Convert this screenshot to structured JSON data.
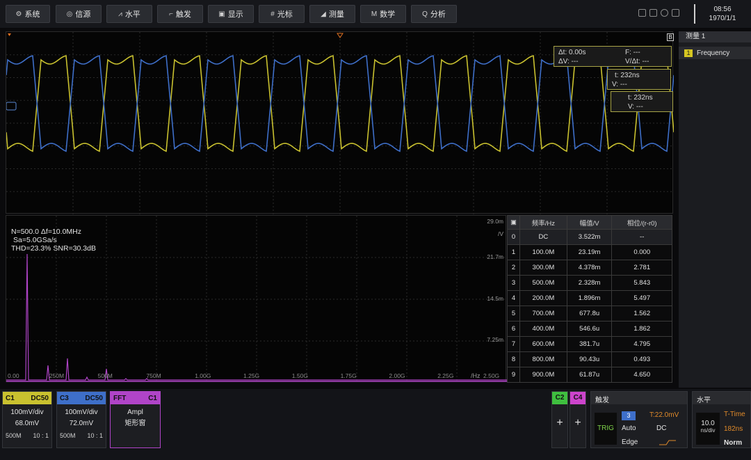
{
  "toolbar": {
    "buttons": [
      {
        "label": "系统",
        "icon": "gear-icon"
      },
      {
        "label": "信源",
        "icon": "source-icon"
      },
      {
        "label": "水平",
        "icon": "horizontal-icon"
      },
      {
        "label": "触发",
        "icon": "trigger-icon"
      },
      {
        "label": "显示",
        "icon": "display-icon"
      },
      {
        "label": "光标",
        "icon": "cursor-icon"
      },
      {
        "label": "测量",
        "icon": "measure-icon"
      },
      {
        "label": "数学",
        "icon": "math-icon"
      },
      {
        "label": "分析",
        "icon": "search-icon"
      }
    ],
    "time": "08:56",
    "date": "1970/1/1"
  },
  "scope": {
    "marker_b": "B",
    "cursor_main": {
      "dt": "Δt: 0.00s",
      "f": "F: ---",
      "dv": "ΔV: ---",
      "vdt": "V/Δt: ---"
    },
    "cursor_a": {
      "t": "t: 232ns",
      "v": "V: ---"
    },
    "cursor_b": {
      "t": "t: 232ns",
      "v": "V: ---"
    },
    "colors": {
      "c1": "#c9c12f",
      "c3": "#3e6fc9"
    }
  },
  "fft": {
    "info1": "N=500.0 Δf=10.0MHz",
    "info2": "Sa=5.0GSa/s",
    "info3": "THD=23.3% SNR=30.3dB",
    "y_labels": [
      "29.0m",
      "21.7m",
      "14.5m",
      "7.25m"
    ],
    "y_unit": "/V",
    "x_labels": [
      "0.00",
      "250M",
      "500M",
      "750M",
      "1.00G",
      "1.25G",
      "1.50G",
      "1.75G",
      "2.00G",
      "2.25G",
      "2.50G"
    ],
    "x_unit": "/Hz",
    "color": "#b044c8"
  },
  "table": {
    "headers": [
      "频率/Hz",
      "幅值/V",
      "相位/(r-r0)"
    ],
    "rows": [
      [
        "0",
        "DC",
        "3.522m",
        "--"
      ],
      [
        "1",
        "100.0M",
        "23.19m",
        "0.000"
      ],
      [
        "2",
        "300.0M",
        "4.378m",
        "2.781"
      ],
      [
        "3",
        "500.0M",
        "2.328m",
        "5.843"
      ],
      [
        "4",
        "200.0M",
        "1.896m",
        "5.497"
      ],
      [
        "5",
        "700.0M",
        "677.8u",
        "1.562"
      ],
      [
        "6",
        "400.0M",
        "546.6u",
        "1.862"
      ],
      [
        "7",
        "600.0M",
        "381.7u",
        "4.795"
      ],
      [
        "8",
        "800.0M",
        "90.43u",
        "0.493"
      ],
      [
        "9",
        "900.0M",
        "61.87u",
        "4.650"
      ]
    ]
  },
  "measure": {
    "title": "测量 1",
    "item_index": "1",
    "item_label": "Frequency"
  },
  "channels": {
    "c1": {
      "name": "C1",
      "coupling": "DC50",
      "scale": "100mV/div",
      "offset": "68.0mV",
      "bw": "500M",
      "probe": "10 : 1"
    },
    "c3": {
      "name": "C3",
      "coupling": "DC50",
      "scale": "100mV/div",
      "offset": "72.0mV",
      "bw": "500M",
      "probe": "10 : 1"
    },
    "fft": {
      "name": "FFT",
      "source": "C1",
      "mode": "Ampl",
      "window": "矩形窗"
    },
    "c2": {
      "name": "C2",
      "plus": "+"
    },
    "c4": {
      "name": "C4",
      "plus": "+"
    }
  },
  "trigger": {
    "title": "触发",
    "trig_label": "TRIG",
    "source": "3",
    "level": "T:22.0mV",
    "mode": "Auto",
    "coupling": "DC",
    "type": "Edge"
  },
  "horizontal": {
    "title": "水平",
    "scale_value": "10.0",
    "scale_unit": "ns/div",
    "time_mode": "T-Time",
    "delay": "182ns",
    "acq": "Norm"
  }
}
